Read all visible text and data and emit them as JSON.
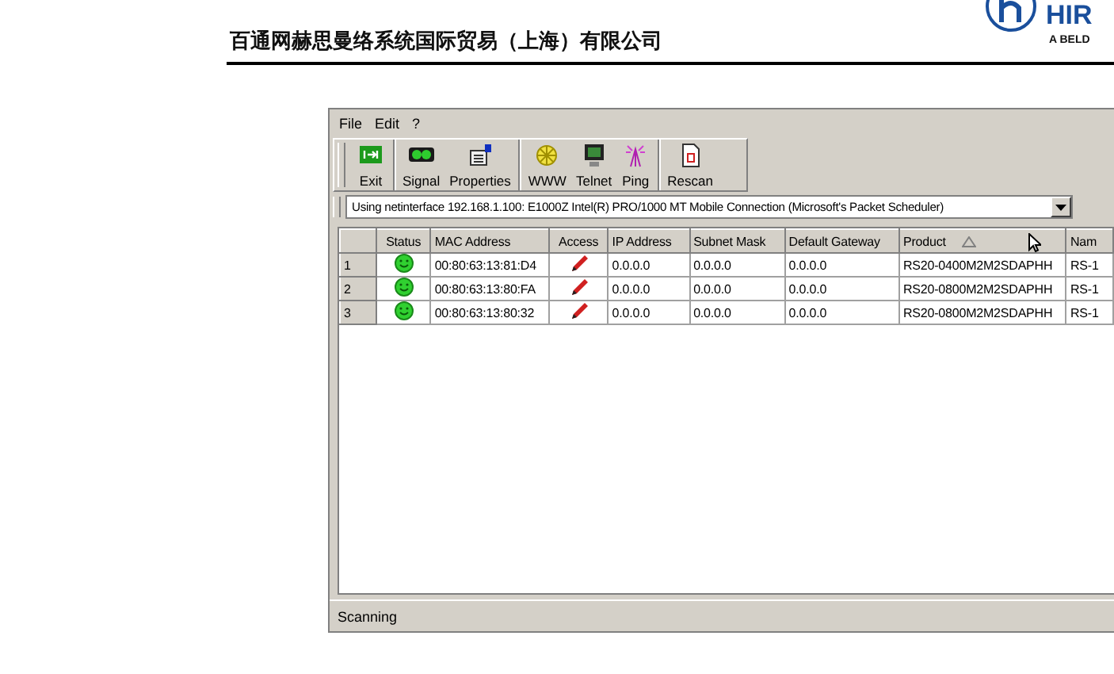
{
  "header": {
    "company_name": "百通网赫思曼络系统国际贸易（上海）有限公司",
    "logo": {
      "text": "HIR",
      "tagline": "A BELD"
    }
  },
  "window": {
    "menu": [
      {
        "label": "File"
      },
      {
        "label": "Edit"
      },
      {
        "label": "?"
      }
    ],
    "toolbar": [
      [
        {
          "label": "Exit",
          "kind": "exit"
        }
      ],
      [
        {
          "label": "Signal",
          "kind": "signal"
        },
        {
          "label": "Properties",
          "kind": "properties"
        }
      ],
      [
        {
          "label": "WWW",
          "kind": "www"
        },
        {
          "label": "Telnet",
          "kind": "telnet"
        },
        {
          "label": "Ping",
          "kind": "ping"
        }
      ],
      [
        {
          "label": "Rescan",
          "kind": "rescan"
        }
      ]
    ],
    "interface": {
      "value": "Using netinterface 192.168.1.100: E1000Z Intel(R) PRO/1000 MT Mobile Connection (Microsoft's Packet Scheduler)"
    },
    "table": {
      "columns": [
        {
          "label": "Status",
          "sorted": false
        },
        {
          "label": "MAC Address",
          "sorted": false
        },
        {
          "label": "Access",
          "sorted": false
        },
        {
          "label": "IP Address",
          "sorted": false
        },
        {
          "label": "Subnet Mask",
          "sorted": false
        },
        {
          "label": "Default Gateway",
          "sorted": false
        },
        {
          "label": "Product",
          "sorted": true
        },
        {
          "label": "Nam",
          "sorted": false
        }
      ],
      "rows": [
        {
          "number": "1",
          "status": {
            "kind": "online"
          },
          "mac": "00:80:63:13:81:D4",
          "access": {
            "kind": "write"
          },
          "ip": "0.0.0.0",
          "subnet": "0.0.0.0",
          "gateway": "0.0.0.0",
          "product": "RS20-0400M2M2SDAPHH",
          "name": "RS-1"
        },
        {
          "number": "2",
          "status": {
            "kind": "online"
          },
          "mac": "00:80:63:13:80:FA",
          "access": {
            "kind": "write"
          },
          "ip": "0.0.0.0",
          "subnet": "0.0.0.0",
          "gateway": "0.0.0.0",
          "product": "RS20-0800M2M2SDAPHH",
          "name": "RS-1"
        },
        {
          "number": "3",
          "status": {
            "kind": "online"
          },
          "mac": "00:80:63:13:80:32",
          "access": {
            "kind": "write"
          },
          "ip": "0.0.0.0",
          "subnet": "0.0.0.0",
          "gateway": "0.0.0.0",
          "product": "RS20-0800M2M2SDAPHH",
          "name": "RS-1"
        }
      ]
    },
    "status_bar": {
      "text": "Scanning"
    }
  }
}
